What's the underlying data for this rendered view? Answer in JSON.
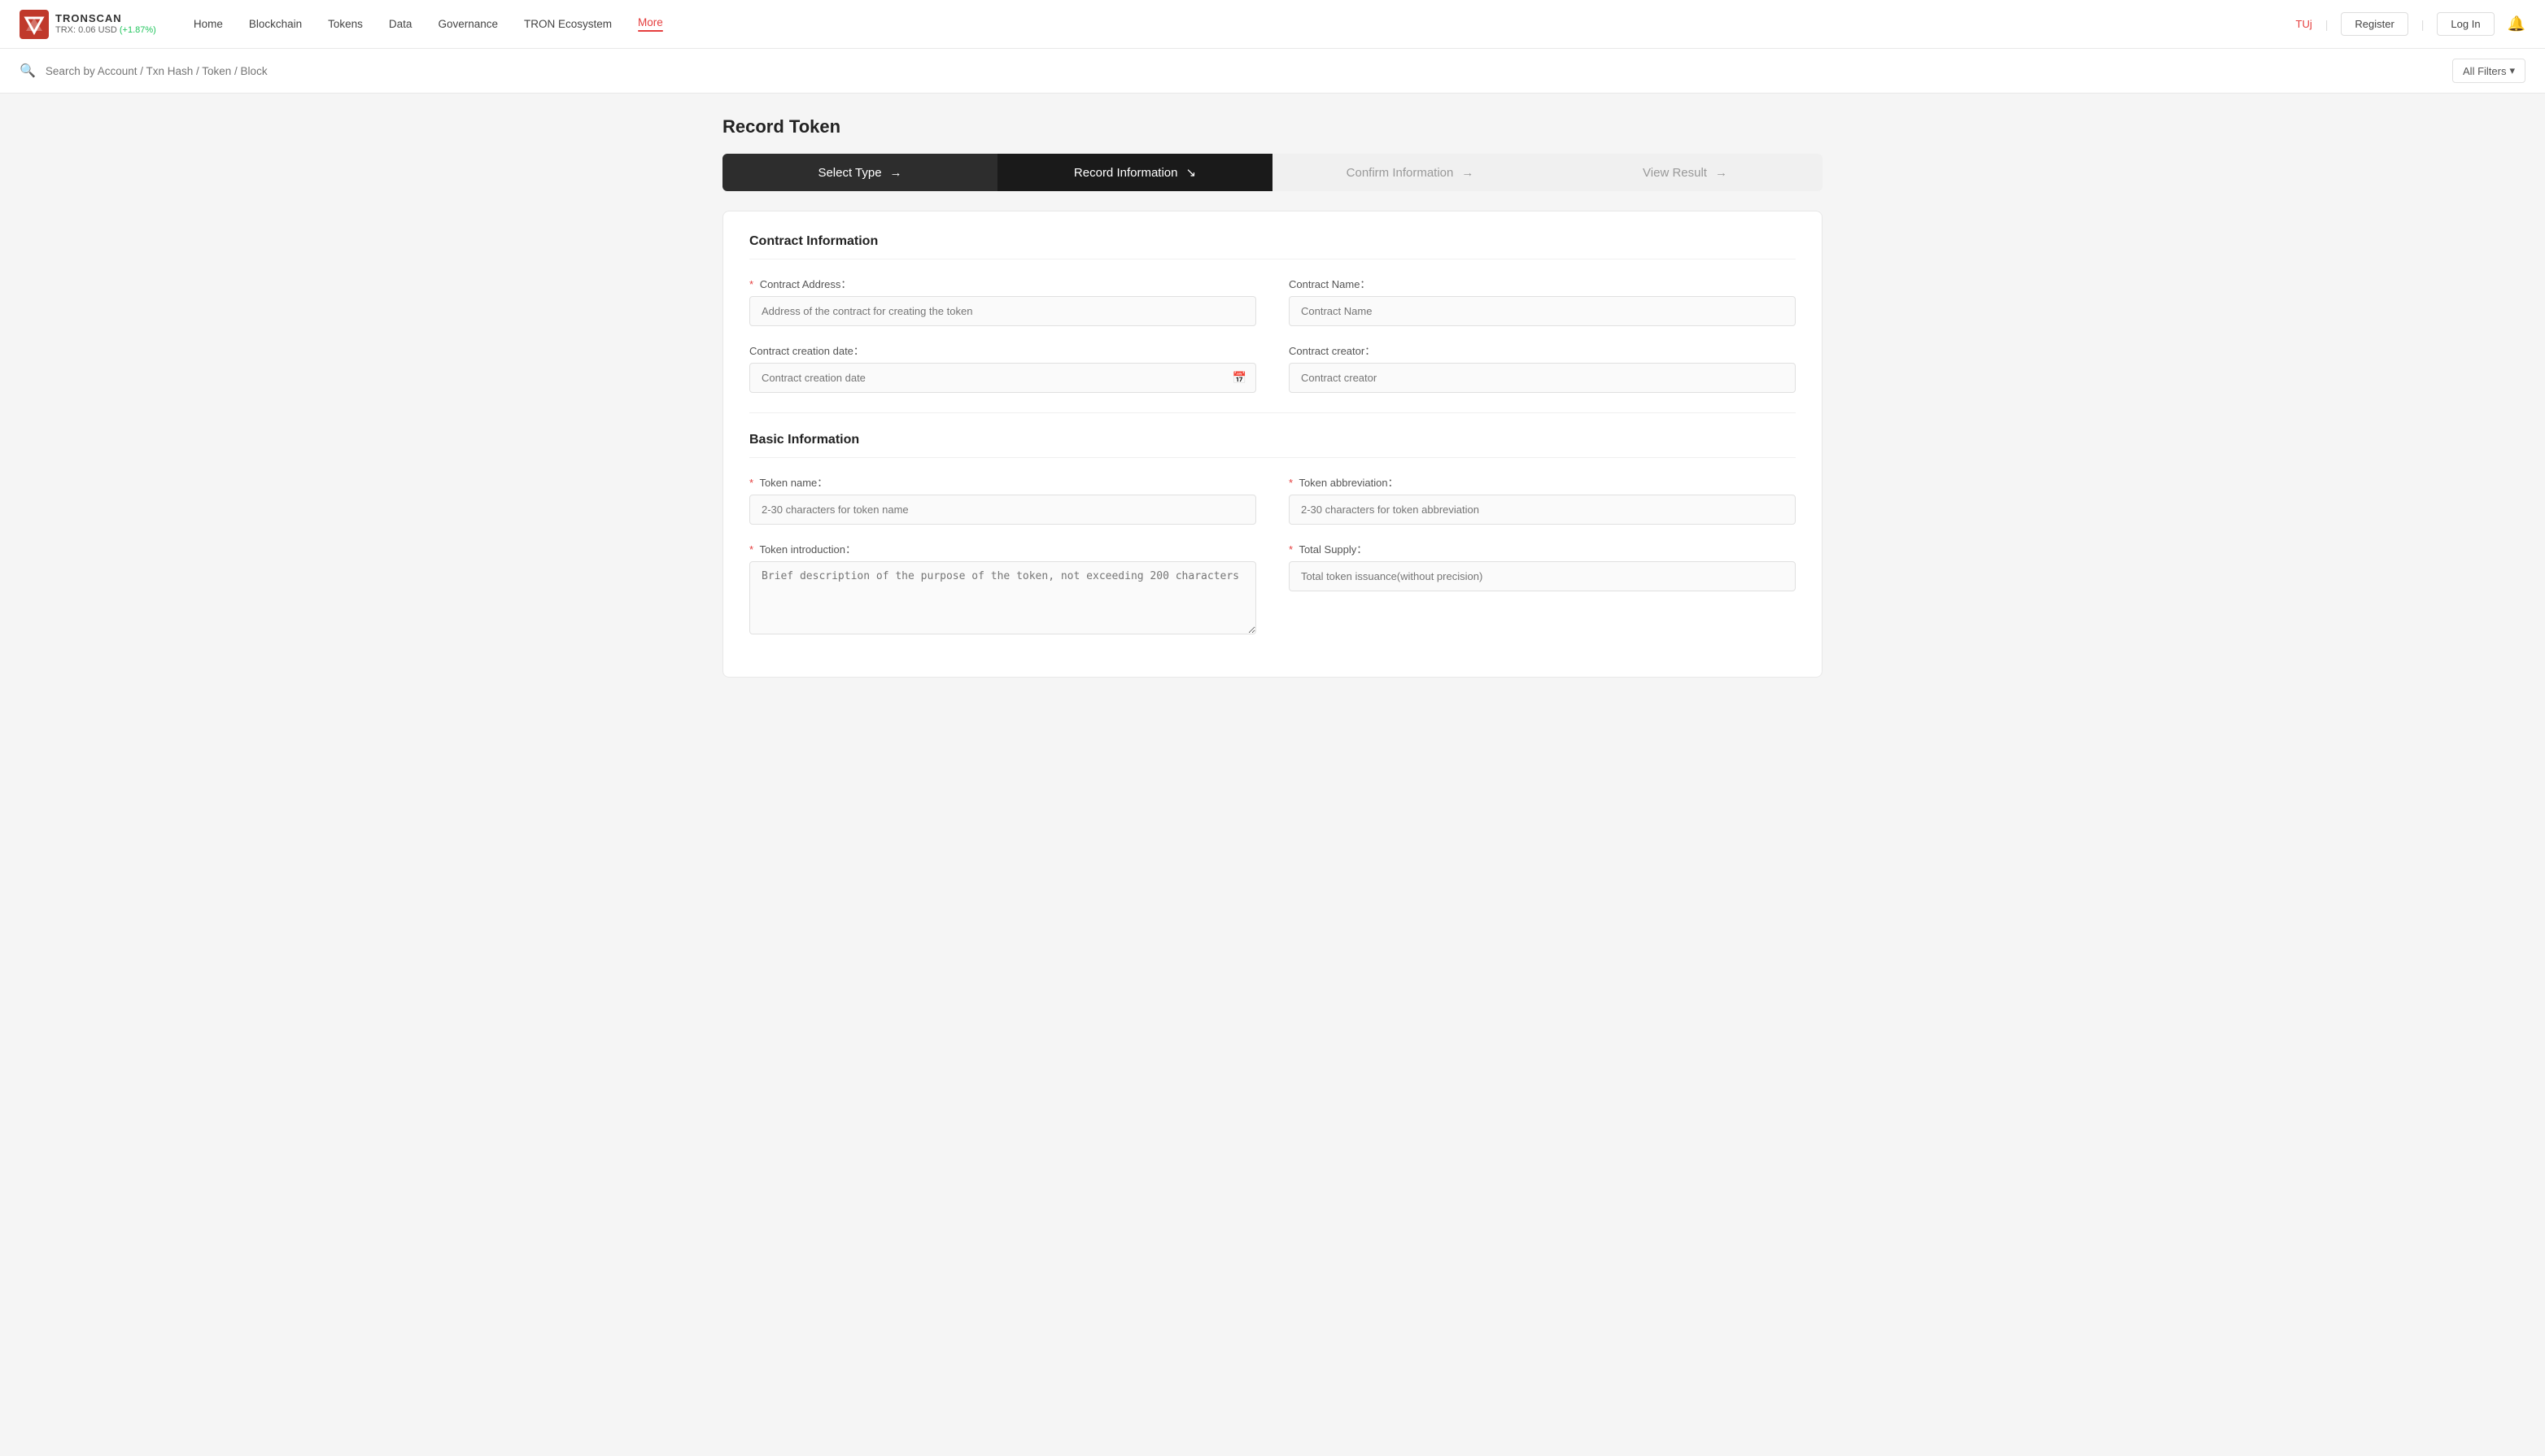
{
  "brand": {
    "name": "TRONSCAN",
    "price_label": "TRX: 0.06 USD",
    "price_change": "(+1.87%)"
  },
  "nav": {
    "links": [
      {
        "id": "home",
        "label": "Home"
      },
      {
        "id": "blockchain",
        "label": "Blockchain"
      },
      {
        "id": "tokens",
        "label": "Tokens"
      },
      {
        "id": "data",
        "label": "Data"
      },
      {
        "id": "governance",
        "label": "Governance"
      },
      {
        "id": "tron-ecosystem",
        "label": "TRON Ecosystem"
      },
      {
        "id": "more",
        "label": "More",
        "active": true
      }
    ],
    "user": "TUj",
    "register": "Register",
    "login": "Log In"
  },
  "search": {
    "placeholder": "Search by Account / Txn Hash / Token / Block",
    "filters_label": "All Filters"
  },
  "page": {
    "title": "Record Token"
  },
  "stepper": {
    "steps": [
      {
        "id": "select-type",
        "label": "Select Type",
        "arrow": "→",
        "state": "completed"
      },
      {
        "id": "record-info",
        "label": "Record Information",
        "arrow": "↘",
        "state": "active"
      },
      {
        "id": "confirm-info",
        "label": "Confirm Information",
        "arrow": "→",
        "state": "inactive"
      },
      {
        "id": "view-result",
        "label": "View Result",
        "arrow": "→",
        "state": "inactive"
      }
    ]
  },
  "contract_section": {
    "title": "Contract Information",
    "fields": {
      "contract_address": {
        "label": "Contract Address：",
        "required": true,
        "placeholder": "Address of the contract for creating the token"
      },
      "contract_name": {
        "label": "Contract Name：",
        "required": false,
        "placeholder": "Contract Name"
      },
      "creation_date": {
        "label": "Contract creation date：",
        "required": false,
        "placeholder": "Contract creation date"
      },
      "contract_creator": {
        "label": "Contract creator：",
        "required": false,
        "placeholder": "Contract creator"
      }
    }
  },
  "basic_section": {
    "title": "Basic Information",
    "fields": {
      "token_name": {
        "label": "Token name：",
        "required": true,
        "placeholder": "2-30 characters for token name"
      },
      "token_abbreviation": {
        "label": "Token abbreviation：",
        "required": true,
        "placeholder": "2-30 characters for token abbreviation"
      },
      "token_intro": {
        "label": "Token introduction：",
        "required": true,
        "placeholder": "Brief description of the purpose of the token, not exceeding 200 characters"
      },
      "total_supply": {
        "label": "Total Supply：",
        "required": true,
        "placeholder": "Total token issuance(without precision)"
      }
    }
  }
}
